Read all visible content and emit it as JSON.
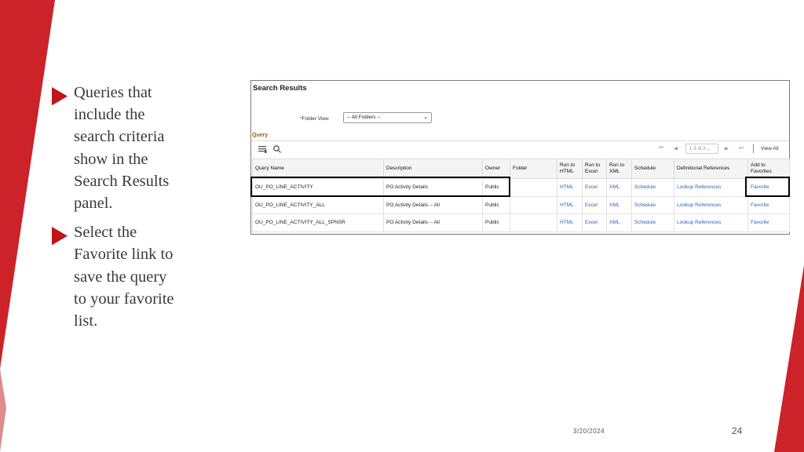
{
  "slide": {
    "bullets": [
      {
        "text": "Queries that\ninclude the\nsearch criteria\nshow in the\nSearch Results\npanel."
      },
      {
        "text": "Select the\nFavorite link to\nsave the query\nto your favorite\nlist."
      }
    ],
    "footer": {
      "date": "3/20/2024",
      "page_number": "24"
    },
    "colors": {
      "accent": "#cc2229",
      "bullet": "#c0151a"
    }
  },
  "panel": {
    "title": "Search Results",
    "folder_view": {
      "label": "*Folder View",
      "value": "-- All Folders --"
    },
    "section_label": "Query",
    "toolbar": {
      "icons": [
        "grid-icon",
        "search-icon"
      ],
      "pager": {
        "range": "1-3 of 3",
        "view_all": "View All"
      }
    },
    "columns": [
      "Query Name",
      "Description",
      "Owner",
      "Folder",
      "Run to\nHTML",
      "Run to\nExcel",
      "Run to\nXML",
      "Schedule",
      "Definitional References",
      "Add to\nFavorites"
    ],
    "rows": [
      {
        "query_name": "OU_PO_LINE_ACTIVITY",
        "description": "PO Activity Details",
        "owner": "Public",
        "folder": "",
        "html": "HTML",
        "excel": "Excel",
        "xml": "XML",
        "schedule": "Schedule",
        "references": "Lookup References",
        "favorite": "Favorite"
      },
      {
        "query_name": "OU_PO_LINE_ACTIVITY_ALL",
        "description": "PO Activity Details -- All",
        "owner": "Public",
        "folder": "",
        "html": "HTML",
        "excel": "Excel",
        "xml": "XML",
        "schedule": "Schedule",
        "references": "Lookup References",
        "favorite": "Favorite"
      },
      {
        "query_name": "OU_PO_LINE_ACTIVITY_ALL_SPNSR",
        "description": "PO Activity Details -- All",
        "owner": "Public",
        "folder": "",
        "html": "HTML",
        "excel": "Excel",
        "xml": "XML",
        "schedule": "Schedule",
        "references": "Lookup References",
        "favorite": "Favorite"
      }
    ],
    "link_color": "#2a64c6"
  }
}
